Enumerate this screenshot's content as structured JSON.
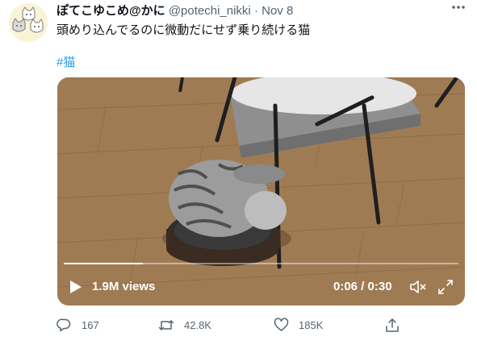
{
  "tweet": {
    "display_name": "ぽてこゆこめ@かに",
    "handle": "@potechi_nikki",
    "separator": "·",
    "date": "Nov 8",
    "more_icon": "more-horizontal-icon",
    "text": "頭めり込んでるのに微動だにせず乗り続ける猫",
    "hashtag": "#猫"
  },
  "video": {
    "views": "1.9M views",
    "current_time": "0:06",
    "duration": "0:30",
    "time_display": "0:06 / 0:30",
    "progress": 0.2,
    "controls": [
      "play-icon",
      "volume-muted-icon",
      "fullscreen-icon"
    ]
  },
  "actions": {
    "reply_count": "167",
    "retweet_count": "42.8K",
    "like_count": "185K",
    "icons": [
      "reply-icon",
      "retweet-icon",
      "like-icon",
      "share-icon"
    ]
  },
  "colors": {
    "link": "#1d9bf0",
    "secondary_text": "#536471",
    "primary_text": "#0f1419"
  }
}
